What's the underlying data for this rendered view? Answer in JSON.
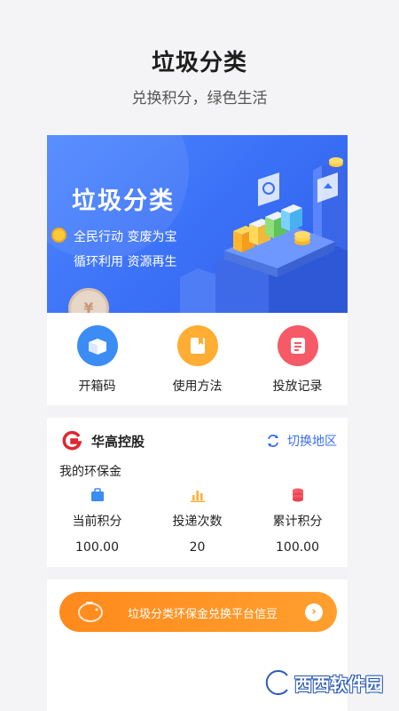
{
  "promo": {
    "title": "垃圾分类",
    "subtitle": "兑换积分，绿色生活"
  },
  "banner": {
    "title": "垃圾分类",
    "line1": "全民行动 变废为宝",
    "line2": "循环利用 资源再生",
    "coin_symbol": "¥"
  },
  "actions": [
    {
      "label": "开箱码",
      "icon": "box-icon",
      "color": "#3b8cf5"
    },
    {
      "label": "使用方法",
      "icon": "book-icon",
      "color": "#ffad33"
    },
    {
      "label": "投放记录",
      "icon": "record-icon",
      "color": "#f55a66"
    }
  ],
  "company": {
    "name": "华高控股",
    "switch_label": "切换地区",
    "wallet_title": "我的环保金",
    "stats": [
      {
        "label": "当前积分",
        "value": "100.00",
        "icon": "wallet-icon",
        "color": "#3b8cf5"
      },
      {
        "label": "投递次数",
        "value": "20",
        "icon": "bar-chart-icon",
        "color": "#ffad33"
      },
      {
        "label": "累计积分",
        "value": "100.00",
        "icon": "coin-stack-icon",
        "color": "#f55a66"
      }
    ]
  },
  "exchange": {
    "label": "垃圾分类环保金兑换平台信豆",
    "arrow": "›"
  },
  "watermark": {
    "text": "西西软件园"
  }
}
